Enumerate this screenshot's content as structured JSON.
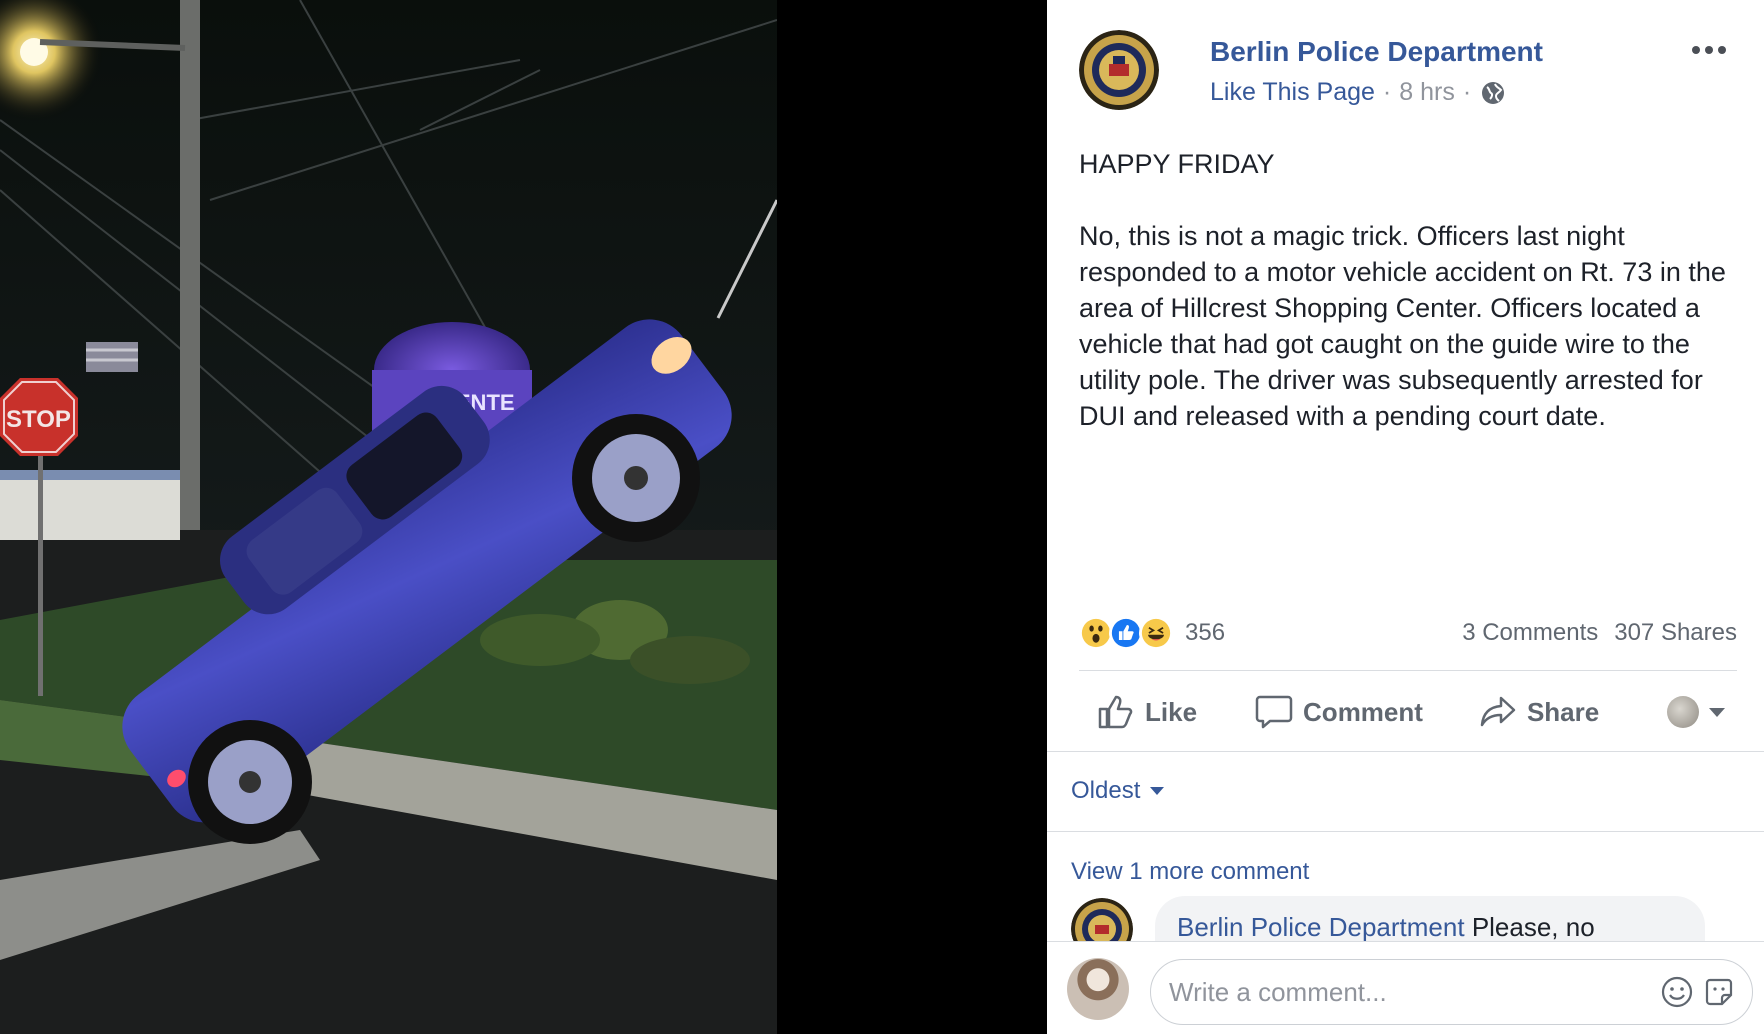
{
  "photo": {
    "signs": {
      "stop": "STOP",
      "shopping_center_partial": "CENTE"
    }
  },
  "post": {
    "page_name": "Berlin Police Department",
    "like_page_label": "Like This Page",
    "separator": "·",
    "time_ago": "8 hrs",
    "audience_icon": "globe-icon",
    "more_icon": "more-options-icon",
    "text_title": "HAPPY FRIDAY",
    "text_body": "No, this is not a magic trick. Officers last night responded to a motor vehicle accident on Rt. 73 in the area of Hillcrest Shopping Center. Officers located a vehicle that had got caught on the guide wire to the utility pole. The driver was subsequently arrested for DUI and released with a pending court date."
  },
  "reactions": {
    "icons": [
      "wow-icon",
      "like-reaction-icon",
      "haha-icon"
    ],
    "count": "356",
    "comments_label": "3 Comments",
    "shares_label": "307 Shares"
  },
  "actions": {
    "like": "Like",
    "comment": "Comment",
    "share": "Share"
  },
  "comments": {
    "sort_label": "Oldest",
    "view_more": "View 1 more comment",
    "items": [
      {
        "author": "Berlin Police Department",
        "text": "Please, no"
      }
    ]
  },
  "composer": {
    "placeholder": "Write a comment...",
    "emoji_icon": "emoji-icon",
    "sticker_icon": "sticker-icon"
  },
  "colors": {
    "link_blue": "#365899",
    "secondary_text": "#90949c",
    "like_blue": "#1877f2",
    "reaction_yellow": "#f7c94a"
  }
}
